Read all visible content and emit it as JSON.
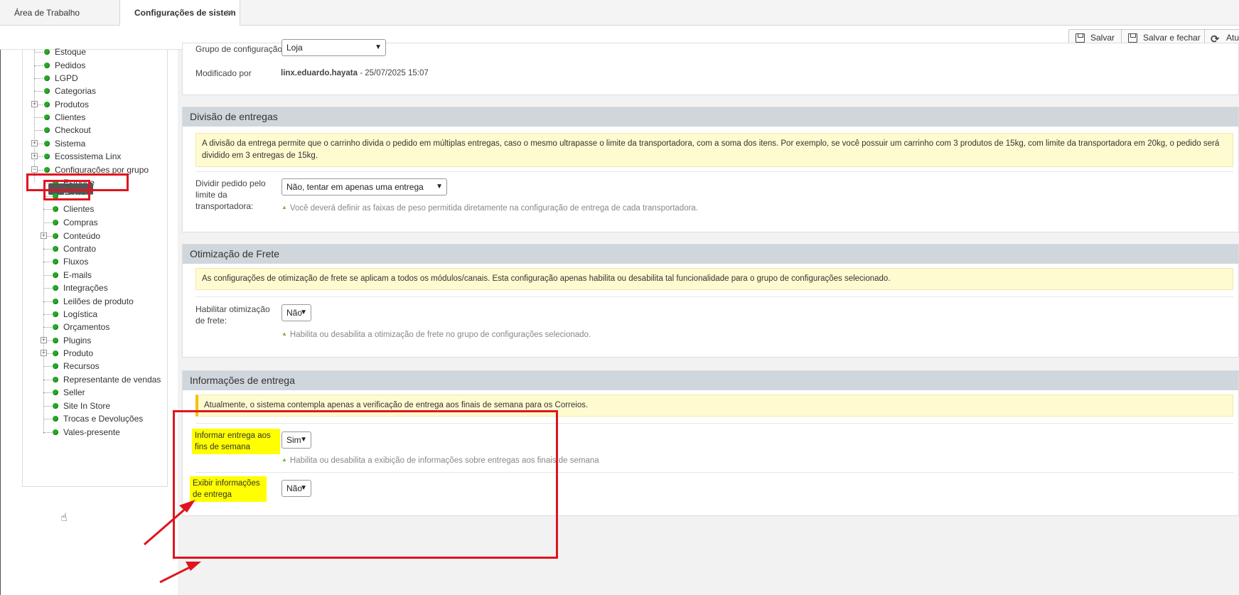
{
  "tabs": {
    "workspace": "Área de Trabalho",
    "config": "Configurações de sistem",
    "close": "✕"
  },
  "toolbar": {
    "save": "Salvar",
    "save_close": "Salvar e fechar",
    "refresh": "Atua"
  },
  "tree": {
    "items": [
      {
        "label": "Estoque"
      },
      {
        "label": "Pedidos"
      },
      {
        "label": "LGPD"
      },
      {
        "label": "Categorias"
      },
      {
        "label": "Produtos"
      },
      {
        "label": "Clientes"
      },
      {
        "label": "Checkout"
      },
      {
        "label": "Sistema"
      },
      {
        "label": "Ecossistema Linx"
      },
      {
        "label": "Configurações por grupo"
      }
    ],
    "children": [
      {
        "label": "Estoque"
      },
      {
        "label": "Entrega"
      },
      {
        "label": "Clientes"
      },
      {
        "label": "Compras"
      },
      {
        "label": "Conteúdo"
      },
      {
        "label": "Contrato"
      },
      {
        "label": "Fluxos"
      },
      {
        "label": "E-mails"
      },
      {
        "label": "Integrações"
      },
      {
        "label": "Leilões de produto"
      },
      {
        "label": "Logística"
      },
      {
        "label": "Orçamentos"
      },
      {
        "label": "Plugins"
      },
      {
        "label": "Produto"
      },
      {
        "label": "Recursos"
      },
      {
        "label": "Representante de vendas"
      },
      {
        "label": "Seller"
      },
      {
        "label": "Site In Store"
      },
      {
        "label": "Trocas e Devoluções"
      },
      {
        "label": "Vales-presente"
      }
    ]
  },
  "general": {
    "group_label": "Grupo de configuração",
    "group_value": "Loja",
    "modified_label": "Modificado por",
    "modified_user": "linx.eduardo.hayata",
    "modified_date": " - 25/07/2025 15:07"
  },
  "divisao": {
    "title": "Divisão de entregas",
    "info": "A divisão da entrega permite que o carrinho divida o pedido em múltiplas entregas, caso o mesmo ultrapasse o limite da transportadora, com a soma dos itens. Por exemplo, se você possuir um carrinho com 3 produtos de 15kg, com limite da transportadora em 20kg, o pedido será dividido em 3 entregas de 15kg.",
    "field_label": "Dividir pedido pelo limite da transportadora:",
    "field_value": "Não, tentar em apenas uma entrega",
    "hint": "Você deverá definir as faixas de peso permitida diretamente na configuração de entrega de cada transportadora."
  },
  "otimizacao": {
    "title": "Otimização de Frete",
    "info": "As configurações de otimização de frete se aplicam a todos os módulos/canais. Esta configuração apenas habilita ou desabilita tal funcionalidade para o grupo de configurações selecionado.",
    "field_label": "Habilitar otimização de frete:",
    "field_value": "Não",
    "hint": "Habilita ou desabilita a otimização de frete no grupo de configurações selecionado."
  },
  "informacoes": {
    "title": "Informações de entrega",
    "info": "Atualmente, o sistema contempla apenas a verificação de entrega aos finais de semana para os Correios.",
    "field1_label": "Informar entrega aos fins de semana",
    "field1_value": "Sim",
    "field1_hint": "Habilita ou desabilita a exibição de informações sobre entregas aos finais de semana",
    "field2_label": "Exibir informações de entrega",
    "field2_value": "Não"
  },
  "colors": {
    "highlight_red": "#e0141e",
    "highlight_yellow": "#ffff00",
    "status_green": "#28a828",
    "section_header": "#cfd6dc"
  }
}
